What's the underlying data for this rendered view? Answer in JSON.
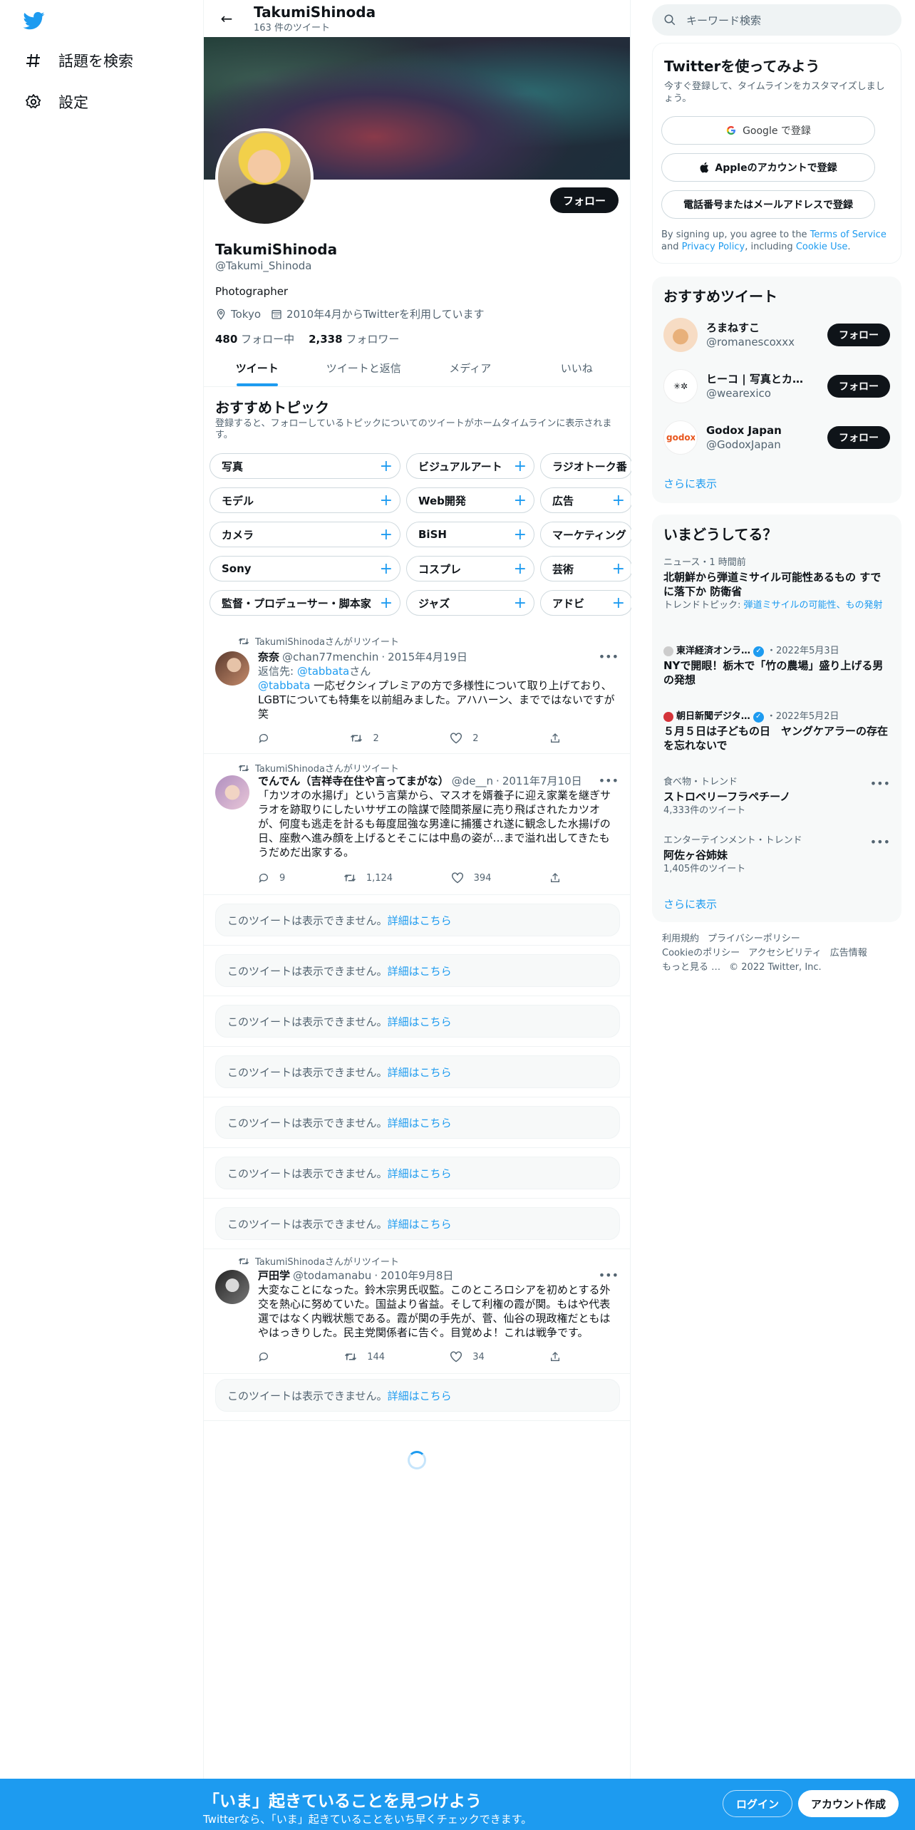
{
  "nav": {
    "items": [
      {
        "label": "話題を検索",
        "icon": "hashtag-icon"
      },
      {
        "label": "設定",
        "icon": "gear-icon"
      }
    ]
  },
  "profile": {
    "header_name": "TakumiShinoda",
    "tweet_count": "163 件のツイート",
    "follow_label": "フォロー",
    "name": "TakumiShinoda",
    "handle": "@Takumi_Shinoda",
    "bio": "Photographer",
    "location": "Tokyo",
    "joined": "2010年4月からTwitterを利用しています",
    "following_count": "480",
    "following_label": "フォロー中",
    "followers_count": "2,338",
    "followers_label": "フォロワー"
  },
  "tabs": [
    {
      "label": "ツイート",
      "active": true
    },
    {
      "label": "ツイートと返信"
    },
    {
      "label": "メディア"
    },
    {
      "label": "いいね"
    }
  ],
  "topics": {
    "title": "おすすめトピック",
    "subtitle": "登録すると、フォローしているトピックについてのツイートがホームタイムラインに表示されます。",
    "rows": [
      [
        "写真",
        "ビジュアルアート",
        "ラジオトーク番"
      ],
      [
        "モデル",
        "Web開発",
        "広告"
      ],
      [
        "カメラ",
        "BiSH",
        "マーケティング"
      ],
      [
        "Sony",
        "コスプレ",
        "芸術"
      ],
      [
        "監督・プロデューサー・脚本家",
        "ジャズ",
        "アドビ"
      ]
    ]
  },
  "tweets": [
    {
      "retweet_label": "TakumiShinodaさんがリツイート",
      "name": "奈奈",
      "handle": "@chan77menchin",
      "date": "2015年4月19日",
      "reply_prefix": "返信先: ",
      "reply_to": "@tabbata",
      "reply_suffix": "さん",
      "mention": "@tabbata",
      "text": " 一応ゼクシィプレミアの方で多様性について取り上げており、LGBTについても特集を以前組みました。アハハーン、までではないですが笑",
      "replies": "",
      "retweets": "2",
      "likes": "2"
    },
    {
      "retweet_label": "TakumiShinodaさんがリツイート",
      "name": "でんでん（吉祥寺在住や言ってまがな）",
      "handle": "@de__n",
      "date": "2011年7月10日",
      "text": "「カツオの水揚げ」という言葉から、マスオを婿養子に迎え家業を継ぎサラオを跡取りにしたいサザエの陰謀で陸間茶屋に売り飛ばされたカツオが、何度も逃走を計るも毎度屈強な男達に捕獲され遂に観念した水揚げの日、座敷へ進み顔を上げるとそこには中島の姿が…まで溢れ出してきたもうだめだ出家する。",
      "replies": "9",
      "retweets": "1,124",
      "likes": "394"
    },
    {
      "retweet_label": "TakumiShinodaさんがリツイート",
      "name": "戸田学",
      "handle": "@todamanabu",
      "date": "2010年9月8日",
      "text": "大変なことになった。鈴木宗男氏収監。このところロシアを初めとする外交を熱心に努めていた。国益より省益。そして利権の霞が関。もはや代表選ではなく内戦状態である。霞が関の手先が、菅、仙谷の現政権だともはやはっきりした。民主党関係者に告ぐ。目覚めよ！これは戦争です。",
      "replies": "",
      "retweets": "144",
      "likes": "34"
    }
  ],
  "unavailable": {
    "text": "このツイートは表示できません。",
    "link": "詳細はこちら"
  },
  "right": {
    "search_placeholder": "キーワード検索",
    "signup": {
      "title": "Twitterを使ってみよう",
      "subtitle": "今すぐ登録して、タイムラインをカスタマイズしましょう。",
      "google": "Google で登録",
      "apple": "Appleのアカウントで登録",
      "phone": "電話番号またはメールアドレスで登録",
      "legal_1": "By signing up, you agree to the ",
      "terms": "Terms of Service",
      "legal_2": " and ",
      "privacy": "Privacy Policy",
      "legal_3": ", including ",
      "cookie": "Cookie Use",
      "legal_4": "."
    },
    "recommend": {
      "title": "おすすめツイート",
      "users": [
        {
          "name": "ろまねすこ",
          "handle": "@romanescoxxx",
          "btn": "フォロー"
        },
        {
          "name": "ヒーコ | 写真とカメ…",
          "handle": "@wearexico",
          "btn": "フォロー"
        },
        {
          "name": "Godox Japan",
          "handle": "@GodoxJapan",
          "btn": "フォロー"
        }
      ],
      "more": "さらに表示"
    },
    "trends": {
      "title": "いまどうしてる？",
      "items": [
        {
          "cat": "ニュース・1 時間前",
          "title": "北朝鮮から弾道ミサイル可能性あるもの すでに落下か 防衛省",
          "extra_prefix": "トレンドトピック: ",
          "extra_link": "弾道ミサイルの可能性、もの発射"
        },
        {
          "cat": "東洋経済オンラ…",
          "date": "・2022年5月3日",
          "title": "NYで開眼！栃木で「竹の農場」盛り上げる男の発想"
        },
        {
          "cat": "朝日新聞デジタ…",
          "date": "・2022年5月2日",
          "title": "５月５日は子どもの日　ヤングケアラーの存在を忘れないで"
        },
        {
          "cat": "食べ物・トレンド",
          "title": "ストロベリーフラペチーノ",
          "count": "4,333件のツイート"
        },
        {
          "cat": "エンターテインメント・トレンド",
          "title": "阿佐ヶ谷姉妹",
          "count": "1,405件のツイート"
        }
      ],
      "more": "さらに表示"
    },
    "footer": [
      "利用規約",
      "プライバシーポリシー",
      "Cookieのポリシー",
      "アクセシビリティ",
      "広告情報",
      "もっと見る …",
      "© 2022 Twitter, Inc."
    ]
  },
  "bottom": {
    "title": "「いま」起きていることを見つけよう",
    "subtitle": "Twitterなら、「いま」起きていることをいち早くチェックできます。",
    "login": "ログイン",
    "signup": "アカウント作成"
  }
}
